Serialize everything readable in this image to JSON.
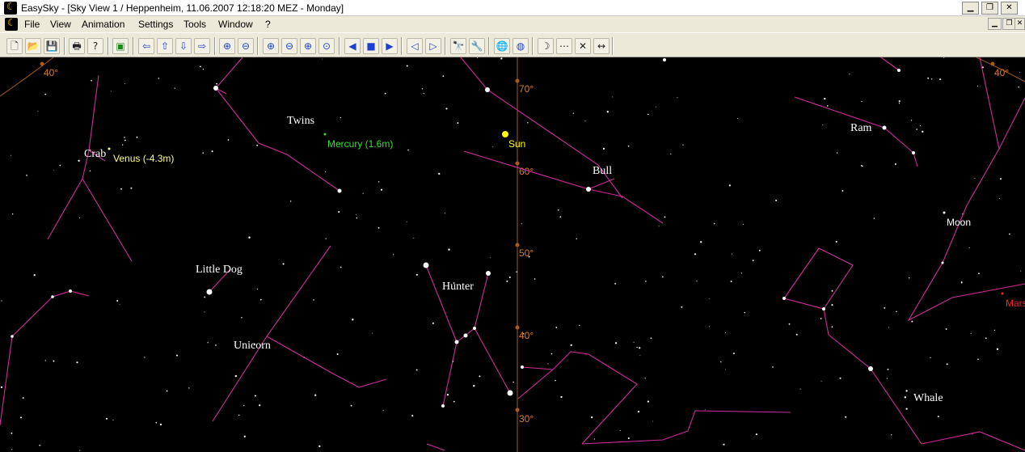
{
  "window": {
    "title": "EasySky - [Sky View 1 /  Heppenheim, 11.06.2007 12:18:20 MEZ - Monday]",
    "controls": [
      "minimize",
      "maximize",
      "close"
    ]
  },
  "menu": {
    "items": [
      "File",
      "View",
      "Animation",
      "Settings",
      "Tools",
      "Window",
      "?"
    ]
  },
  "toolbar": {
    "buttons": [
      {
        "name": "new-icon",
        "glyph": "🗋"
      },
      {
        "name": "open-folder-icon",
        "glyph": "📂"
      },
      {
        "name": "save-icon",
        "glyph": "💾"
      },
      {
        "name": "print-icon",
        "glyph": "🖶"
      },
      {
        "name": "help-cursor-icon",
        "glyph": "?"
      },
      {
        "name": "sky-view-icon",
        "glyph": "▣"
      },
      {
        "name": "arrow-left-icon",
        "glyph": "⇦"
      },
      {
        "name": "arrow-up-icon",
        "glyph": "⇧"
      },
      {
        "name": "arrow-down-icon",
        "glyph": "⇩"
      },
      {
        "name": "arrow-right-icon",
        "glyph": "⇨"
      },
      {
        "name": "zoom-in-icon",
        "glyph": "⊕"
      },
      {
        "name": "zoom-out-icon",
        "glyph": "⊖"
      },
      {
        "name": "zoom-in-2-icon",
        "glyph": "⊕"
      },
      {
        "name": "zoom-out-2-icon",
        "glyph": "⊖"
      },
      {
        "name": "zoom-in-3-icon",
        "glyph": "⊕"
      },
      {
        "name": "zoom-reset-icon",
        "glyph": "⊙"
      },
      {
        "name": "play-back-icon",
        "glyph": "◀"
      },
      {
        "name": "stop-icon",
        "glyph": "■"
      },
      {
        "name": "play-forward-icon",
        "glyph": "▶"
      },
      {
        "name": "step-back-icon",
        "glyph": "◁"
      },
      {
        "name": "step-forward-icon",
        "glyph": "▷"
      },
      {
        "name": "binoculars-icon",
        "glyph": "🔭"
      },
      {
        "name": "tools-icon",
        "glyph": "🔧"
      },
      {
        "name": "globe-icon",
        "glyph": "🌐"
      },
      {
        "name": "earth-icon",
        "glyph": "◍"
      },
      {
        "name": "moon-phase-icon",
        "glyph": "☽"
      },
      {
        "name": "dotted-line-icon",
        "glyph": "⋯"
      },
      {
        "name": "constellation-lines-icon",
        "glyph": "✕"
      },
      {
        "name": "measure-distance-icon",
        "glyph": "↔"
      }
    ]
  },
  "sky": {
    "constellation_labels": [
      "Twins",
      "Crab",
      "Little Dog",
      "Unicorn",
      "Hunter",
      "Bull",
      "Ram",
      "Whale"
    ],
    "planets": [
      {
        "label": "Venus  (-4.3m)",
        "color": "#ffff80"
      },
      {
        "label": "Mercury  (1.6m)",
        "color": "#30e030"
      },
      {
        "label": "Sun",
        "color": "#ffff00"
      },
      {
        "label": "Moon",
        "color": "#ffffff"
      },
      {
        "label": "Mars",
        "color": "#ff2020"
      }
    ],
    "altitude_labels": [
      "70°",
      "60°",
      "50°",
      "40°",
      "30°"
    ],
    "corner_labels": [
      "40°",
      "40°"
    ],
    "colors": {
      "background": "#000000",
      "constellation_lines": "#d02c9c",
      "grid": "#c07020",
      "stars": "#ffffff"
    }
  }
}
